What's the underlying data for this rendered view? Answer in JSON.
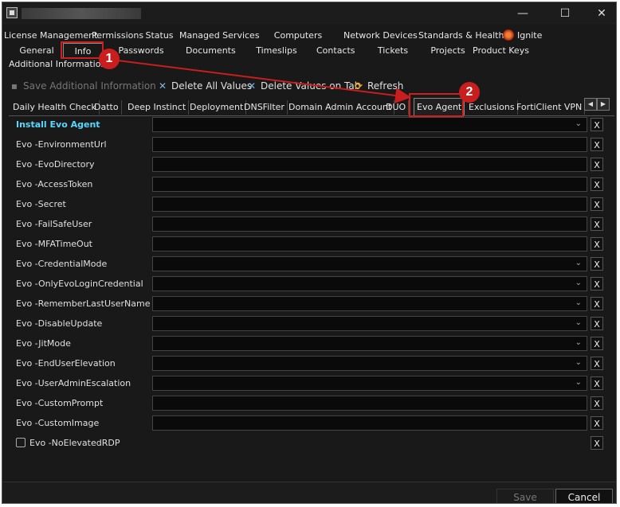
{
  "window": {
    "title": ""
  },
  "window_controls": {
    "minimize": "—",
    "maximize": "☐",
    "close": "✕"
  },
  "top_tabs_row1": [
    "License Management",
    "Permissions",
    "Status",
    "Managed Services",
    "Computers",
    "Network Devices",
    "Standards & Health",
    "Ignite"
  ],
  "top_tabs_row2": [
    "General",
    "Info",
    "Passwords",
    "Documents",
    "Timeslips",
    "Contacts",
    "Tickets",
    "Projects",
    "Product Keys"
  ],
  "section_label": "Additional Information",
  "toolbar": {
    "save_label": "Save Additional Information",
    "delete_all_label": "Delete All Values",
    "delete_tab_label": "Delete Values on Tab",
    "refresh_label": "Refresh"
  },
  "sub_tabs": [
    "Daily Health Check",
    "Datto",
    "Deep Instinct",
    "Deployment",
    "DNSFilter",
    "Domain Admin Account",
    "DUO",
    "Evo Agent",
    "Exclusions",
    "FortiClient VPN"
  ],
  "active_sub_tab": "Evo Agent",
  "fields": [
    {
      "label": "Install Evo Agent",
      "type": "dropdown",
      "heading": true
    },
    {
      "label": "Evo -EnvironmentUrl",
      "type": "text"
    },
    {
      "label": "Evo -EvoDirectory",
      "type": "text"
    },
    {
      "label": "Evo -AccessToken",
      "type": "text"
    },
    {
      "label": "Evo -Secret",
      "type": "text"
    },
    {
      "label": "Evo -FailSafeUser",
      "type": "text"
    },
    {
      "label": "Evo -MFATimeOut",
      "type": "text"
    },
    {
      "label": "Evo -CredentialMode",
      "type": "dropdown"
    },
    {
      "label": "Evo -OnlyEvoLoginCredential",
      "type": "dropdown"
    },
    {
      "label": "Evo -RememberLastUserName",
      "type": "dropdown"
    },
    {
      "label": "Evo -DisableUpdate",
      "type": "dropdown"
    },
    {
      "label": "Evo -JitMode",
      "type": "dropdown"
    },
    {
      "label": "Evo -EndUserElevation",
      "type": "dropdown"
    },
    {
      "label": "Evo -UserAdminEscalation",
      "type": "dropdown"
    },
    {
      "label": "Evo -CustomPrompt",
      "type": "text"
    },
    {
      "label": "Evo -CustomImage",
      "type": "text"
    },
    {
      "label": "Evo -NoElevatedRDP",
      "type": "checkbox"
    }
  ],
  "clear_label": "X",
  "footer": {
    "save_label": "Save",
    "cancel_label": "Cancel"
  },
  "annotations": {
    "badge1": "1",
    "badge2": "2",
    "color": "#c81e1e"
  }
}
